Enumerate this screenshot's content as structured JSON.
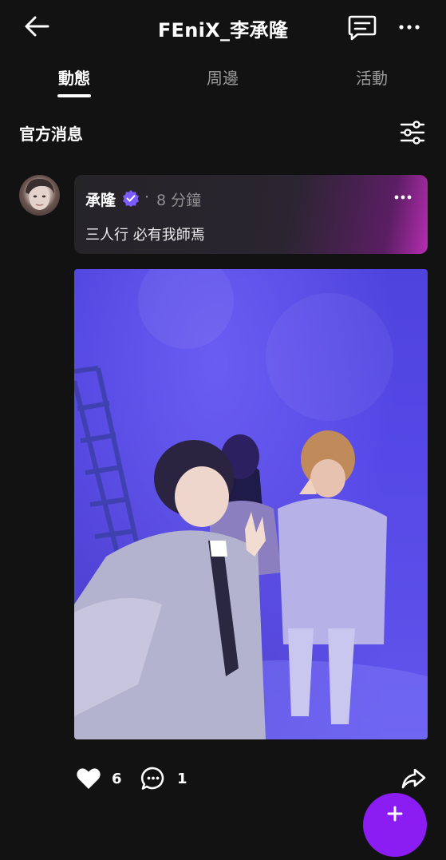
{
  "header": {
    "title": "FEniX_李承隆",
    "back_icon": "arrow-left-icon",
    "chat_icon": "message-square-icon",
    "more_icon": "more-horizontal-icon"
  },
  "tabs": [
    {
      "label": "動態",
      "active": true
    },
    {
      "label": "周邊",
      "active": false
    },
    {
      "label": "活動",
      "active": false
    }
  ],
  "section": {
    "title": "官方消息",
    "filter_icon": "sliders-icon"
  },
  "post": {
    "author": "承隆",
    "verified": true,
    "separator": "·",
    "time": "8 分鐘",
    "text": "三人行 必有我師焉",
    "image_icon": "photo",
    "likes": "6",
    "comments": "1"
  },
  "colors": {
    "background": "#121212",
    "accent": "#8b1df2",
    "verified_badge": "#7b5cff"
  }
}
